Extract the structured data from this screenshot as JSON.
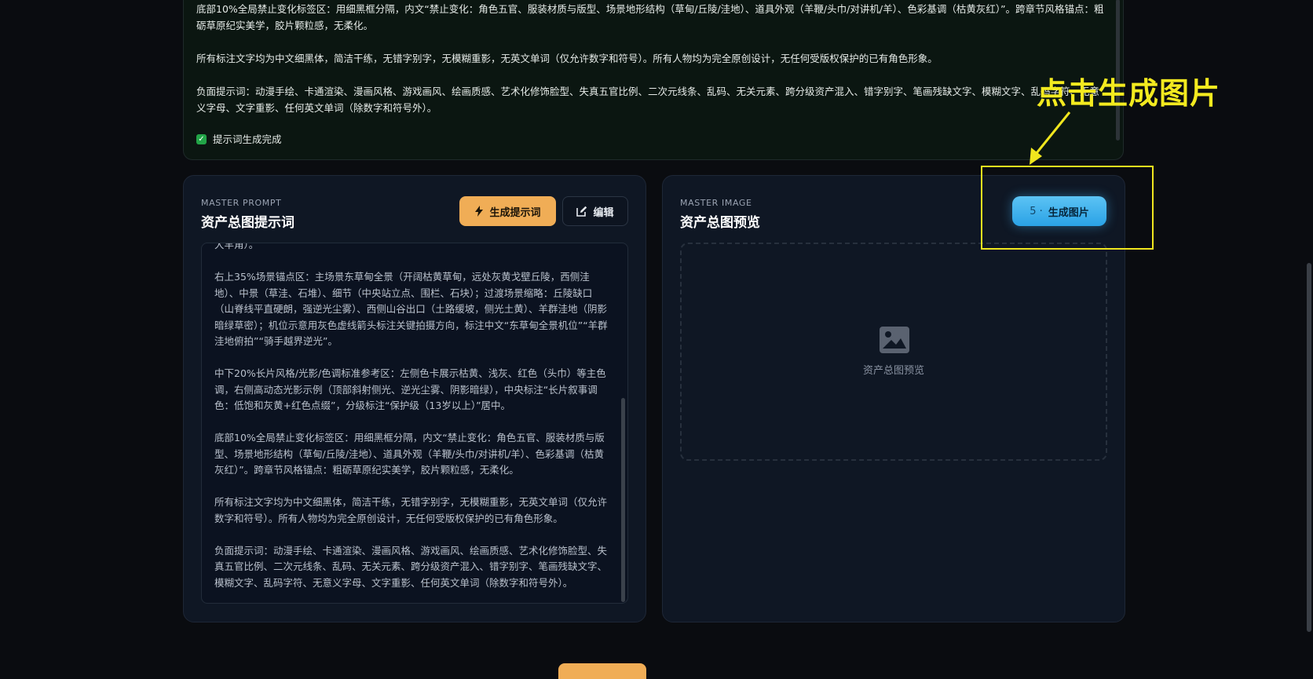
{
  "top_panel": {
    "paragraphs": [
      "底部10%全局禁止变化标签区：用细黑框分隔，内文“禁止变化：角色五官、服装材质与版型、场景地形结构（草甸/丘陵/洼地）、道具外观（羊鞭/头巾/对讲机/羊）、色彩基调（枯黄灰红）”。跨章节风格锚点：粗砺草原纪实美学，胶片颗粒感，无柔化。",
      "所有标注文字均为中文细黑体，简洁干练，无错字别字，无模糊重影，无英文单词（仅允许数字和符号）。所有人物均为完全原创设计，无任何受版权保护的已有角色形象。",
      "负面提示词：动漫手绘、卡通渲染、漫画风格、游戏画风、绘画质感、艺术化修饰脸型、失真五官比例、二次元线条、乱码、无关元素、跨分级资产混入、错字别字、笔画残缺文字、模糊文字、乱码字符、无意义字母、文字重影、任何英文单词（除数字和符号外）。"
    ],
    "status_text": "提示词生成完成"
  },
  "left_card": {
    "eyebrow": "MASTER PROMPT",
    "title": "资产总图提示词",
    "generate_label": "生成提示词",
    "edit_label": "编辑",
    "prompt_paragraphs": [
      "大羊角）。",
      "右上35%场景锚点区：主场景东草甸全景（开阔枯黄草甸，远处灰黄戈壁丘陵，西侧洼地）、中景（草洼、石堆）、细节（中央站立点、围栏、石块）；过渡场景缩略：丘陵缺口（山脊线平直硬朗，强逆光尘雾）、西侧山谷出口（土路缓坡，侧光土黄）、羊群洼地（阴影暗绿草密）；机位示意用灰色虚线箭头标注关键拍摄方向，标注中文“东草甸全景机位”“羊群洼地俯拍”“骑手越界逆光”。",
      "中下20%长片风格/光影/色调标准参考区：左侧色卡展示枯黄、浅灰、红色（头巾）等主色调，右侧高动态光影示例（顶部斜射侧光、逆光尘雾、阴影暗绿），中央标注“长片叙事调色：低饱和灰黄+红色点缀”，分级标注“保护级（13岁以上）”居中。",
      "底部10%全局禁止变化标签区：用细黑框分隔，内文“禁止变化：角色五官、服装材质与版型、场景地形结构（草甸/丘陵/洼地）、道具外观（羊鞭/头巾/对讲机/羊）、色彩基调（枯黄灰红）”。跨章节风格锚点：粗砺草原纪实美学，胶片颗粒感，无柔化。",
      "所有标注文字均为中文细黑体，简洁干练，无错字别字，无模糊重影，无英文单词（仅允许数字和符号）。所有人物均为完全原创设计，无任何受版权保护的已有角色形象。",
      "负面提示词：动漫手绘、卡通渲染、漫画风格、游戏画风、绘画质感、艺术化修饰脸型、失真五官比例、二次元线条、乱码、无关元素、跨分级资产混入、错字别字、笔画残缺文字、模糊文字、乱码字符、无意义字母、文字重影、任何英文单词（除数字和符号外）。"
    ]
  },
  "right_card": {
    "eyebrow": "MASTER IMAGE",
    "title": "资产总图预览",
    "generate_num": "5 ·",
    "generate_label": "生成图片",
    "preview_label": "资产总图预览"
  },
  "annotation": {
    "text": "点击生成图片",
    "color": "#f3ea1f"
  },
  "colors": {
    "accent_orange": "#f0ad56",
    "accent_blue": "#2aa2e6",
    "success_green": "#22a447"
  },
  "icons": {
    "generate_prompt": "bolt-icon",
    "edit": "edit-icon",
    "preview": "image-icon",
    "status": "check-icon"
  }
}
